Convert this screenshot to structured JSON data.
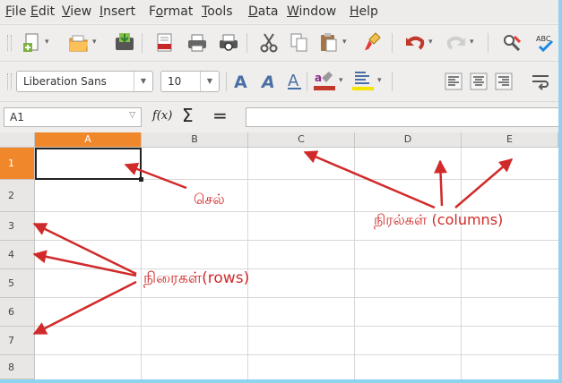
{
  "menubar": {
    "items": [
      {
        "label": "File",
        "mn": "F",
        "rest": "ile"
      },
      {
        "label": "Edit",
        "mn": "E",
        "rest": "dit"
      },
      {
        "label": "View",
        "mn": "V",
        "rest": "iew"
      },
      {
        "label": "Insert",
        "mn": "I",
        "rest": "nsert"
      },
      {
        "label": "Format",
        "pre": "F",
        "mn": "o",
        "rest": "rmat"
      },
      {
        "label": "Tools",
        "mn": "T",
        "rest": "ools"
      },
      {
        "label": "Data",
        "mn": "D",
        "rest": "ata"
      },
      {
        "label": "Window",
        "mn": "W",
        "rest": "indow"
      },
      {
        "label": "Help",
        "mn": "H",
        "rest": "elp"
      }
    ]
  },
  "standard_toolbar": {
    "icons": [
      "new-document-icon",
      "open-folder-icon",
      "save-icon",
      "export-pdf-icon",
      "print-icon",
      "print-preview-icon",
      "cut-icon",
      "copy-icon",
      "paste-icon",
      "clone-formatting-icon",
      "undo-icon",
      "redo-icon",
      "find-replace-icon",
      "spellcheck-icon"
    ]
  },
  "formatting_toolbar": {
    "font_name": "Liberation Sans",
    "font_size": "10",
    "icons": [
      "bold-icon",
      "italic-icon",
      "underline-icon",
      "font-color-icon",
      "highlight-color-icon",
      "align-left-icon",
      "align-center-icon",
      "align-right-icon",
      "wrap-text-icon"
    ]
  },
  "formula_bar": {
    "name_box": "A1",
    "function_wizard": "f(x)",
    "sum_symbol": "Σ",
    "equals_symbol": "=",
    "formula_value": ""
  },
  "sheet": {
    "columns": [
      "A",
      "B",
      "C",
      "D",
      "E"
    ],
    "rows": [
      "1",
      "2",
      "3",
      "4",
      "5",
      "6",
      "7",
      "8"
    ],
    "active_cell": "A1",
    "active_column": "A",
    "active_row": "1"
  },
  "annotations": {
    "cell_label": "செல்",
    "columns_label": "நிரல்கள் (columns)",
    "rows_label": "நிரைகள்(rows)",
    "color": "#d12a2a"
  },
  "colors": {
    "accent_orange": "#f0872a",
    "frame_blue": "#8fd3f0"
  }
}
